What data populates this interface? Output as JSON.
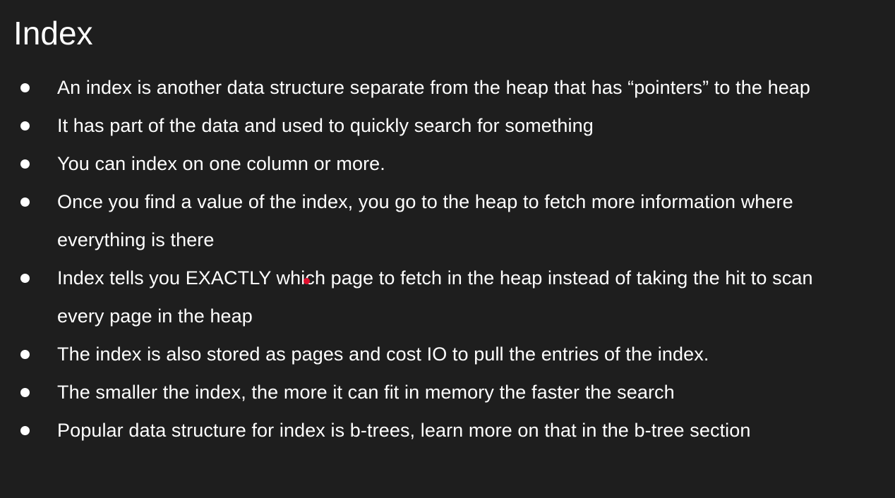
{
  "slide": {
    "title": "Index",
    "bullets": [
      "An index is another data structure separate from the heap that has “pointers” to the heap",
      "It has part of the data and used to quickly search for something",
      "You can index on one column or more.",
      "Once you find a value of the index, you go to the heap to fetch more information where everything is there",
      "Index tells you EXACTLY which page to fetch in the heap instead of taking the hit to scan every page in the heap",
      "The index is also stored as pages and cost IO to pull the entries of the index.",
      "The smaller the index, the more it can fit in memory the faster the search",
      "Popular data structure for index is b-trees, learn more on that in the b-tree section"
    ]
  },
  "colors": {
    "background": "#1e1e1e",
    "text": "#ffffff",
    "pointer": "#e0102e"
  },
  "icons": {
    "bullet": "bullet-dot-icon",
    "pointer": "laser-pointer-icon"
  }
}
